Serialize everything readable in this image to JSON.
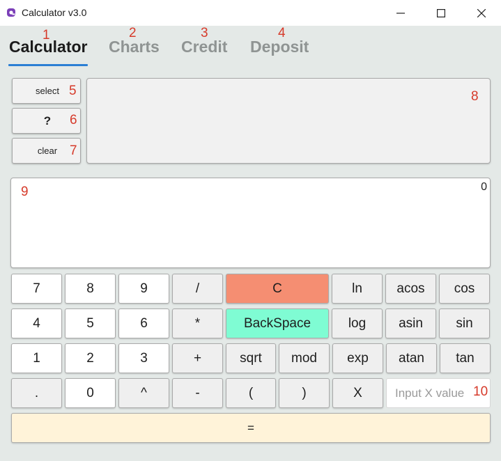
{
  "window": {
    "title": "Calculator v3.0",
    "icon": "app-logo-icon",
    "controls": [
      "minimize-icon",
      "maximize-icon",
      "close-icon"
    ]
  },
  "tabs": [
    {
      "label": "Calculator",
      "active": true
    },
    {
      "label": "Charts",
      "active": false
    },
    {
      "label": "Credit",
      "active": false
    },
    {
      "label": "Deposit",
      "active": false
    }
  ],
  "sidebar": {
    "select_label": "select",
    "help_label": "?",
    "clear_label": "clear"
  },
  "history": {
    "text": ""
  },
  "display": {
    "value": "0"
  },
  "keys": {
    "r1": [
      "7",
      "8",
      "9",
      "/",
      "C",
      "ln",
      "acos",
      "cos"
    ],
    "r2": [
      "4",
      "5",
      "6",
      "*",
      "BackSpace",
      "log",
      "asin",
      "sin"
    ],
    "r3": [
      "1",
      "2",
      "3",
      "+",
      "sqrt",
      "mod",
      "exp",
      "atan",
      "tan"
    ],
    "r4": [
      ".",
      "0",
      "^",
      "-",
      "(",
      ")",
      "X"
    ],
    "equals": "="
  },
  "x_input": {
    "placeholder": "Input X value",
    "value": ""
  },
  "annotations": [
    "1",
    "2",
    "3",
    "4",
    "5",
    "6",
    "7",
    "8",
    "9",
    "10"
  ],
  "colors": {
    "clear_key": "#f58e72",
    "backspace_key": "#7ffcd3",
    "equals_key": "#fff3d9",
    "active_tab_underline": "#2b7fd4",
    "annotation": "#d63a2a"
  }
}
